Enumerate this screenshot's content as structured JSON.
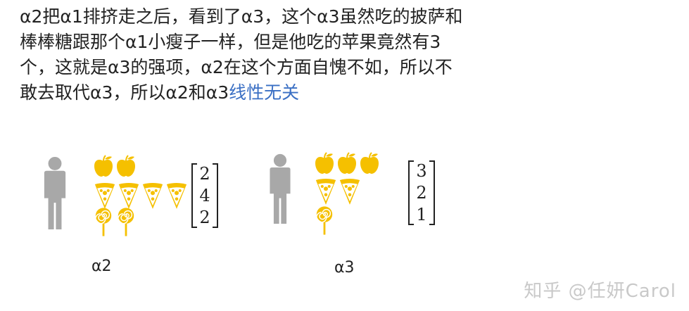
{
  "paragraph": {
    "line1": "α2把α1排挤走之后，看到了α3，这个α3虽然吃的披萨和",
    "line2": "棒棒糖跟那个α1小瘦子一样，但是他吃的苹果竟然有3",
    "line3": "个，这就是α3的强项，α2在这个方面自愧不如，所以不",
    "line4_prefix": "敢去取代α3，所以α2和α3",
    "line4_highlight": "线性无关"
  },
  "figures": [
    {
      "caption": "α2",
      "vector": [
        "2",
        "4",
        "2"
      ],
      "apples": 2,
      "pizzas": 4,
      "lollipops": 2
    },
    {
      "caption": "α3",
      "vector": [
        "3",
        "2",
        "1"
      ],
      "apples": 3,
      "pizzas": 2,
      "lollipops": 1
    }
  ],
  "watermark": "知乎 @任妍Carol",
  "colors": {
    "person": "#a8a8a8",
    "food": "#f5c000",
    "highlight": "#3a6fc4"
  }
}
